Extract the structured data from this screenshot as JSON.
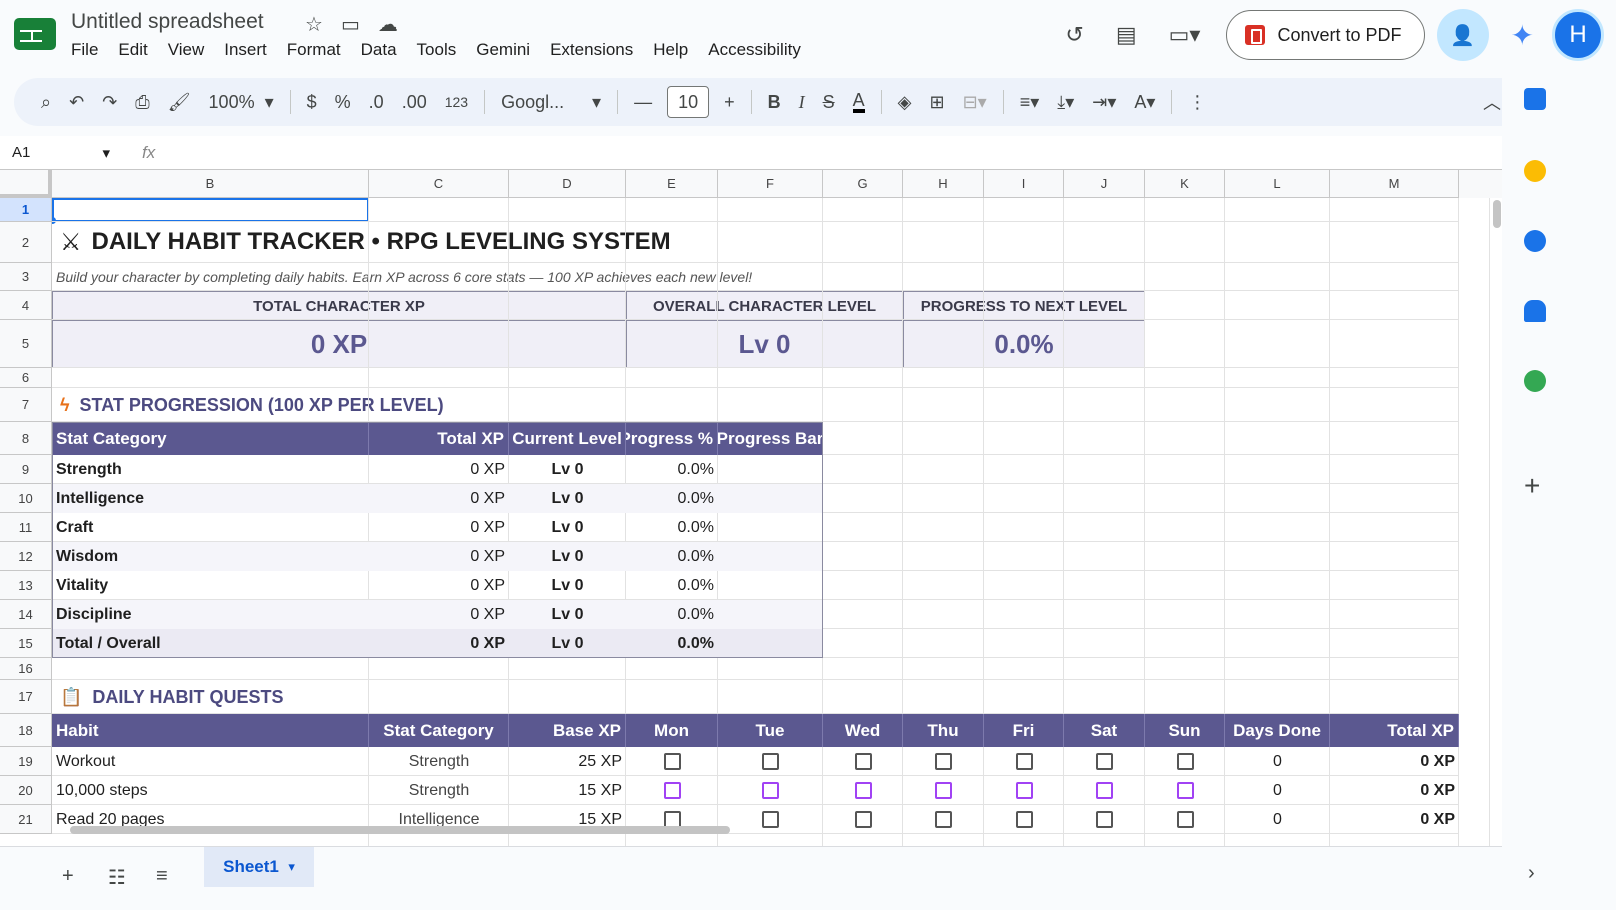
{
  "doc": {
    "title": "Untitled spreadsheet"
  },
  "menu": [
    "File",
    "Edit",
    "View",
    "Insert",
    "Format",
    "Data",
    "Tools",
    "Gemini",
    "Extensions",
    "Help",
    "Accessibility"
  ],
  "actions": {
    "convert_pdf": "Convert to PDF",
    "avatar_letter": "H"
  },
  "toolbar": {
    "zoom": "100%",
    "currency": "$",
    "percent": "%",
    "dec_less": ".0",
    "dec_more": ".00",
    "number_format": "123",
    "font": "Googl...",
    "font_size": "10",
    "bold": "B",
    "italic": "I",
    "text_color": "A"
  },
  "formula_bar": {
    "cell_ref": "A1",
    "fx": "fx",
    "value": ""
  },
  "columns": [
    "B",
    "C",
    "D",
    "E",
    "F",
    "G",
    "H",
    "I",
    "J",
    "K",
    "L",
    "M"
  ],
  "rows": [
    "1",
    "2",
    "3",
    "4",
    "5",
    "6",
    "7",
    "8",
    "9",
    "10",
    "11",
    "12",
    "13",
    "14",
    "15",
    "16",
    "17",
    "18",
    "19",
    "20",
    "21"
  ],
  "sheet": {
    "title": "DAILY HABIT TRACKER • RPG LEVELING SYSTEM",
    "subtitle": "Build your character by completing daily habits. Earn XP across 6 core stats — 100 XP achieves each new level!",
    "summary": [
      {
        "label": "TOTAL CHARACTER XP",
        "value": "0 XP"
      },
      {
        "label": "OVERALL CHARACTER LEVEL",
        "value": "Lv 0"
      },
      {
        "label": "PROGRESS TO NEXT LEVEL",
        "value": "0.0%"
      }
    ],
    "stat_section_title": "STAT PROGRESSION (100 XP PER LEVEL)",
    "stat_headers": [
      "Stat Category",
      "Total XP",
      "Current Level",
      "Progress %",
      "Progress Bar"
    ],
    "stats": [
      {
        "name": "Strength",
        "xp": "0 XP",
        "level": "Lv 0",
        "pct": "0.0%"
      },
      {
        "name": "Intelligence",
        "xp": "0 XP",
        "level": "Lv 0",
        "pct": "0.0%"
      },
      {
        "name": "Craft",
        "xp": "0 XP",
        "level": "Lv 0",
        "pct": "0.0%"
      },
      {
        "name": "Wisdom",
        "xp": "0 XP",
        "level": "Lv 0",
        "pct": "0.0%"
      },
      {
        "name": "Vitality",
        "xp": "0 XP",
        "level": "Lv 0",
        "pct": "0.0%"
      },
      {
        "name": "Discipline",
        "xp": "0 XP",
        "level": "Lv 0",
        "pct": "0.0%"
      },
      {
        "name": "Total / Overall",
        "xp": "0 XP",
        "level": "Lv 0",
        "pct": "0.0%"
      }
    ],
    "quest_section_title": "DAILY HABIT QUESTS",
    "quest_headers": [
      "Habit",
      "Stat Category",
      "Base XP",
      "Mon",
      "Tue",
      "Wed",
      "Thu",
      "Fri",
      "Sat",
      "Sun",
      "Days Done",
      "Total XP"
    ],
    "quests": [
      {
        "habit": "Workout",
        "cat": "Strength",
        "base": "25 XP",
        "days": "0",
        "total": "0 XP"
      },
      {
        "habit": "10,000 steps",
        "cat": "Strength",
        "base": "15 XP",
        "days": "0",
        "total": "0 XP"
      },
      {
        "habit": "Read 20 pages",
        "cat": "Intelligence",
        "base": "15 XP",
        "days": "0",
        "total": "0 XP"
      }
    ]
  },
  "sheet_tab": "Sheet1",
  "colors": {
    "header_purple": "#5b5890",
    "summary_bg": "#f0eff7",
    "accent_blue": "#1a73e8"
  }
}
